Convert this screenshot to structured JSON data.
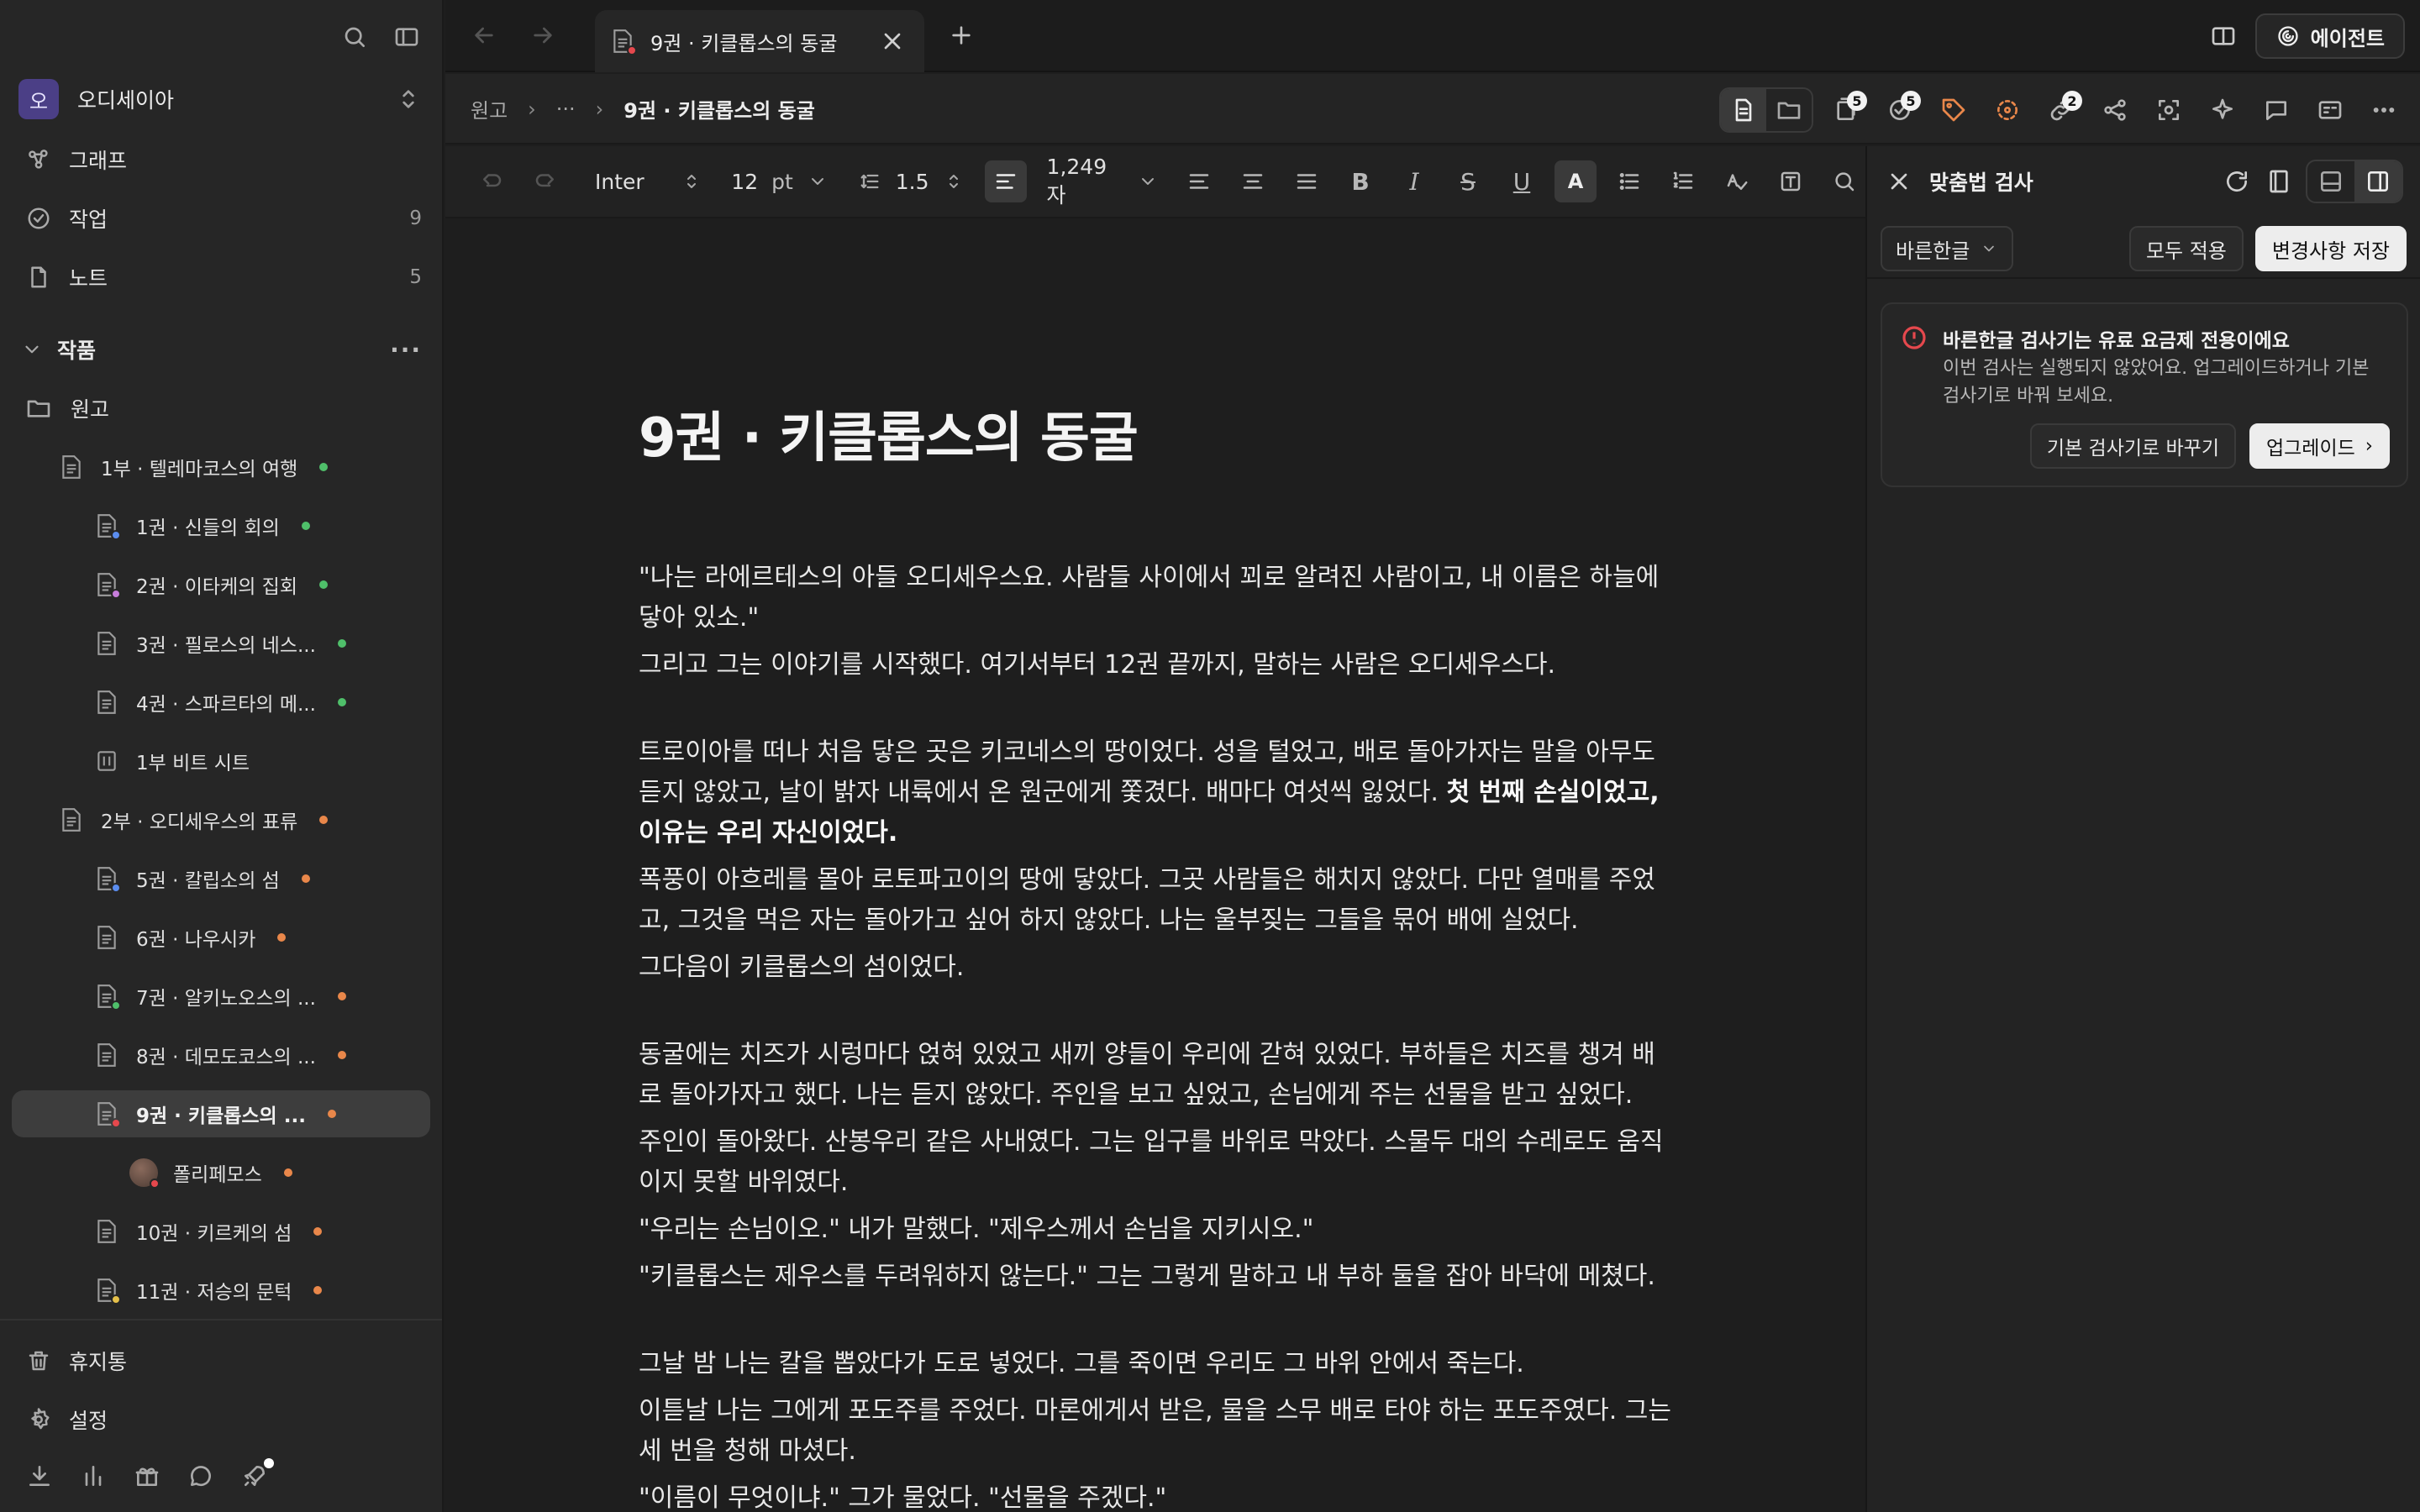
{
  "sidebar": {
    "workspace": {
      "avatar": "오",
      "name": "오디세이아"
    },
    "nav": [
      {
        "label": "그래프",
        "count": ""
      },
      {
        "label": "작업",
        "count": "9"
      },
      {
        "label": "노트",
        "count": "5"
      }
    ],
    "section": {
      "label": "작품",
      "more": "···"
    },
    "tree": [
      {
        "label": "원고"
      },
      {
        "label": "1부 · 텔레마코스의 여행"
      },
      {
        "label": "1권 · 신들의 회의"
      },
      {
        "label": "2권 · 이타케의 집회"
      },
      {
        "label": "3권 · 필로스의 네스..."
      },
      {
        "label": "4권 · 스파르타의 메..."
      },
      {
        "label": "1부 비트 시트"
      },
      {
        "label": "2부 · 오디세우스의 표류"
      },
      {
        "label": "5권 · 칼립소의 섬"
      },
      {
        "label": "6권 · 나우시카"
      },
      {
        "label": "7권 · 알키노오스의 ..."
      },
      {
        "label": "8권 · 데모도코스의 ..."
      },
      {
        "label": "9권 · 키클롭스의 ..."
      },
      {
        "label": "폴리페모스"
      },
      {
        "label": "10권 · 키르케의 섬"
      },
      {
        "label": "11권 · 저승의 문턱"
      }
    ],
    "bottom": [
      {
        "label": "휴지통"
      },
      {
        "label": "설정"
      }
    ]
  },
  "tabs": {
    "active_title": "9권 · 키클롭스의 동굴",
    "agent_label": "에이전트"
  },
  "breadcrumb": {
    "root": "원고",
    "ellipsis": "···",
    "current": "9권 · 키클롭스의 동굴",
    "counts": {
      "docs": "5",
      "tasks": "5",
      "links": "2"
    }
  },
  "format": {
    "font": "Inter",
    "size": "12",
    "size_unit": "pt",
    "line_height": "1.5",
    "char_count": "1,249 자",
    "color_letter": "A",
    "bold": "B",
    "italic": "I",
    "strike": "S",
    "underline": "U"
  },
  "document": {
    "title": "9권 · 키클롭스의 동굴",
    "paragraphs": [
      "\"나는 라에르테스의 아들 오디세우스요. 사람들 사이에서 꾀로 알려진 사람이고, 내 이름은 하늘에 닿아 있소.\"",
      "그리고 그는 이야기를 시작했다. 여기서부터 12권 끝까지, 말하는 사람은 오디세우스다.",
      "트로이아를 떠나 처음 닿은 곳은 키코네스의 땅이었다. 성을 털었고, 배로 돌아가자는 말을 아무도 듣지 않았고, 날이 밝자 내륙에서 온 원군에게 쫓겼다. 배마다 여섯씩 잃었다. ",
      "첫 번째 손실이었고, 이유는 우리 자신이었다.",
      "폭풍이 아흐레를 몰아 로토파고이의 땅에 닿았다. 그곳 사람들은 해치지 않았다. 다만 열매를 주었고, 그것을 먹은 자는 돌아가고 싶어 하지 않았다. 나는 울부짖는 그들을 묶어 배에 실었다.",
      "그다음이 키클롭스의 섬이었다.",
      "동굴에는 치즈가 시렁마다 얹혀 있었고 새끼 양들이 우리에 갇혀 있었다. 부하들은 치즈를 챙겨 배로 돌아가자고 했다. 나는 듣지 않았다. 주인을 보고 싶었고, 손님에게 주는 선물을 받고 싶었다.",
      "주인이 돌아왔다. 산봉우리 같은 사내였다. 그는 입구를 바위로 막았다. 스물두 대의 수레로도 움직이지 못할 바위였다.",
      "\"우리는 손님이오.\" 내가 말했다. \"제우스께서 손님을 지키시오.\"",
      "\"키클롭스는 제우스를 두려워하지 않는다.\" 그는 그렇게 말하고 내 부하 둘을 잡아 바닥에 메쳤다.",
      "그날 밤 나는 칼을 뽑았다가 도로 넣었다. 그를 죽이면 우리도 그 바위 안에서 죽는다.",
      "이튿날 나는 그에게 포도주를 주었다. 마론에게서 받은, 물을 스무 배로 타야 하는 포도주였다. 그는 세 번을 청해 마셨다.",
      "\"이름이 무엇이냐.\" 그가 물었다. \"선물을 주겠다.\""
    ]
  },
  "panel": {
    "title": "맞춤법 검사",
    "checker": "바른한글",
    "apply_all": "모두 적용",
    "save_changes": "변경사항 저장",
    "alert": {
      "title": "바른한글 검사기는 유료 요금제 전용이에요",
      "description": "이번 검사는 실행되지 않았어요. 업그레이드하거나 기본 검사기로 바꿔 보세요.",
      "switch_label": "기본 검사기로 바꾸기",
      "upgrade_label": "업그레이드"
    }
  },
  "colors": {
    "status_green": "#4fbf6a",
    "status_orange": "#e9874a",
    "alert_red": "#e5484d"
  }
}
